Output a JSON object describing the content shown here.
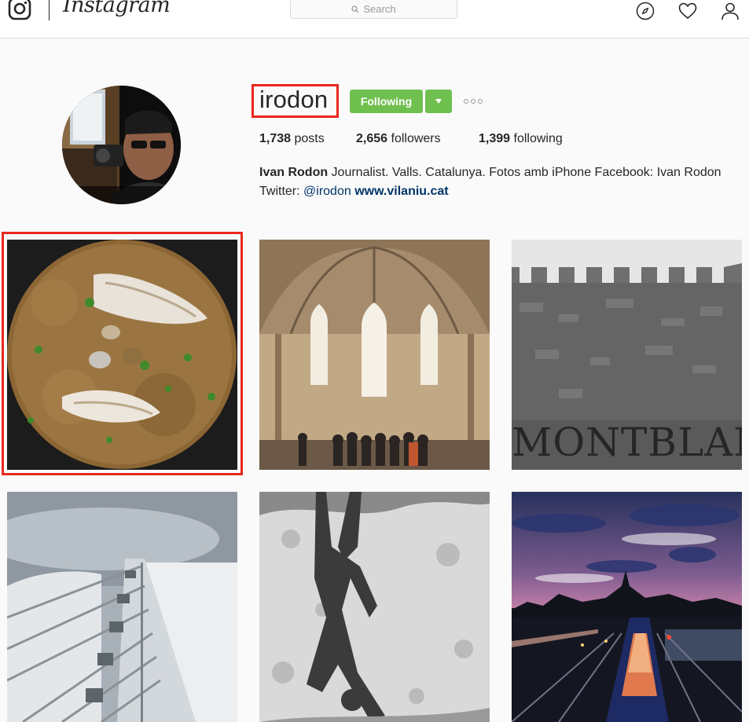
{
  "header": {
    "app_name": "Instagram",
    "search_placeholder": "Search",
    "icons": [
      "instagram-logo-icon",
      "search-icon",
      "compass-icon",
      "heart-icon",
      "person-icon"
    ]
  },
  "profile": {
    "username": "irodon",
    "follow_button_label": "Following",
    "stats": {
      "posts_count": "1,738",
      "posts_label": "posts",
      "followers_count": "2,656",
      "followers_label": "followers",
      "following_count": "1,399",
      "following_label": "following"
    },
    "bio": {
      "full_name": "Ivan Rodon",
      "text": " Journalist. Valls. Catalunya. Fotos amb iPhone Facebook: Ivan Rodon",
      "twitter_prefix": "Twitter: ",
      "mention": "@irodon",
      "website": "www.vilaniu.cat"
    }
  },
  "posts": [
    {
      "subject": "rice-dish-with-fish",
      "highlighted": true
    },
    {
      "subject": "gothic-church-interior",
      "highlighted": false
    },
    {
      "subject": "montblanc-city-wall",
      "highlighted": false
    },
    {
      "subject": "white-building-facade",
      "highlighted": false
    },
    {
      "subject": "puddle-reflection",
      "highlighted": false
    },
    {
      "subject": "sunset-train-city",
      "highlighted": false
    }
  ],
  "colors": {
    "follow_green": "#70c050",
    "highlight_red": "#e8271f",
    "link_blue": "#003569",
    "page_bg": "#fafafa"
  }
}
